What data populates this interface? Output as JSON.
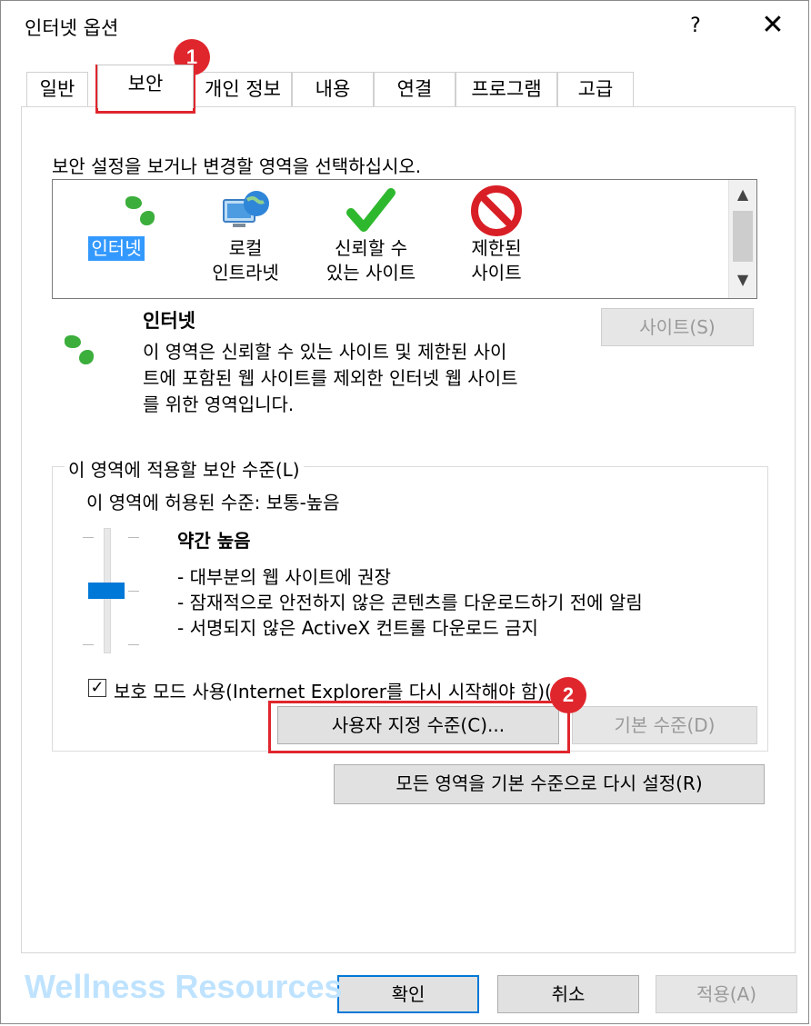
{
  "window": {
    "title": "인터넷 옵션",
    "help_label": "?",
    "close_label": "✕"
  },
  "tabs": [
    {
      "label": "일반"
    },
    {
      "label": "보안"
    },
    {
      "label": "개인 정보"
    },
    {
      "label": "내용"
    },
    {
      "label": "연결"
    },
    {
      "label": "프로그램"
    },
    {
      "label": "고급"
    }
  ],
  "security": {
    "instruction": "보안 설정을 보거나 변경할 영역을 선택하십시오.",
    "zones": [
      {
        "label": "인터넷",
        "icon": "globe-icon",
        "selected": true
      },
      {
        "line1": "로컬",
        "line2": "인트라넷",
        "icon": "intranet-icon"
      },
      {
        "line1": "신뢰할 수",
        "line2": "있는 사이트",
        "icon": "check-icon"
      },
      {
        "line1": "제한된",
        "line2": "사이트",
        "icon": "restricted-icon"
      }
    ],
    "selected_zone": {
      "title": "인터넷",
      "desc1": "이 영역은 신뢰할 수 있는 사이트 및 제한된 사이",
      "desc2": "트에 포함된 웹 사이트를 제외한 인터넷 웹 사이트",
      "desc3": "를 위한 영역입니다.",
      "sites_button": "사이트(S)"
    },
    "level_group": {
      "legend": "이 영역에 적용할 보안 수준(L)",
      "allowed": "이 영역에 허용된 수준: 보통-높음",
      "level_title": "약간 높음",
      "level_items": [
        "- 대부분의 웹 사이트에 권장",
        "- 잠재적으로 안전하지 않은 콘텐츠를 다운로드하기 전에 알림",
        "- 서명되지 않은 ActiveX 컨트롤 다운로드 금지"
      ],
      "slider_level_fraction": 0.5,
      "protected_mode_label": "보호 모드 사용(Internet Explorer를 다시 시작해야 함)(P)",
      "protected_mode_checked": true,
      "custom_level_button": "사용자 지정 수준(C)...",
      "default_level_button": "기본 수준(D)"
    },
    "reset_all_button": "모든 영역을 기본 수준으로 다시 설정(R)"
  },
  "footer": {
    "ok": "확인",
    "cancel": "취소",
    "apply": "적용(A)"
  },
  "annotations": {
    "badge1": "1",
    "badge2": "2",
    "highlight_color": "#e0262d"
  },
  "watermark": "Wellness Resources"
}
